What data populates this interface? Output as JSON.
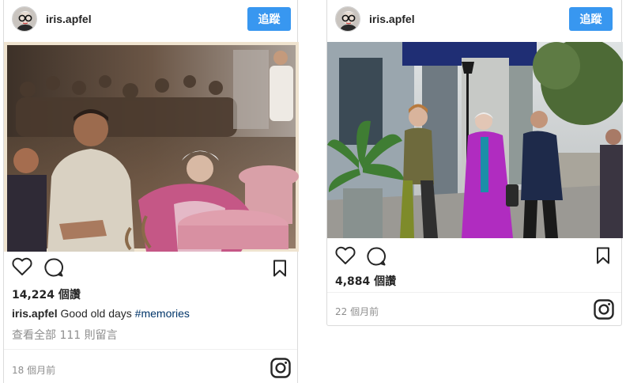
{
  "posts": [
    {
      "username": "iris.apfel",
      "follow_label": "追蹤",
      "likes": "14,224 個讚",
      "caption": {
        "user": "iris.apfel",
        "text": "Good old days",
        "hashtag": "#memories"
      },
      "comments_link": "查看全部 111 則留言",
      "timestamp": "18 個月前"
    },
    {
      "username": "iris.apfel",
      "follow_label": "追蹤",
      "likes": "4,884 個讚",
      "timestamp": "22 個月前"
    }
  ],
  "icons": {
    "like": "heart-icon",
    "comment": "comment-bubble-icon",
    "save": "bookmark-icon",
    "brand": "instagram-logo-icon"
  },
  "colors": {
    "follow_button": "#3897f0",
    "hashtag": "#003569",
    "muted_text": "#8e8e8e",
    "border": "#dbdbdb"
  }
}
